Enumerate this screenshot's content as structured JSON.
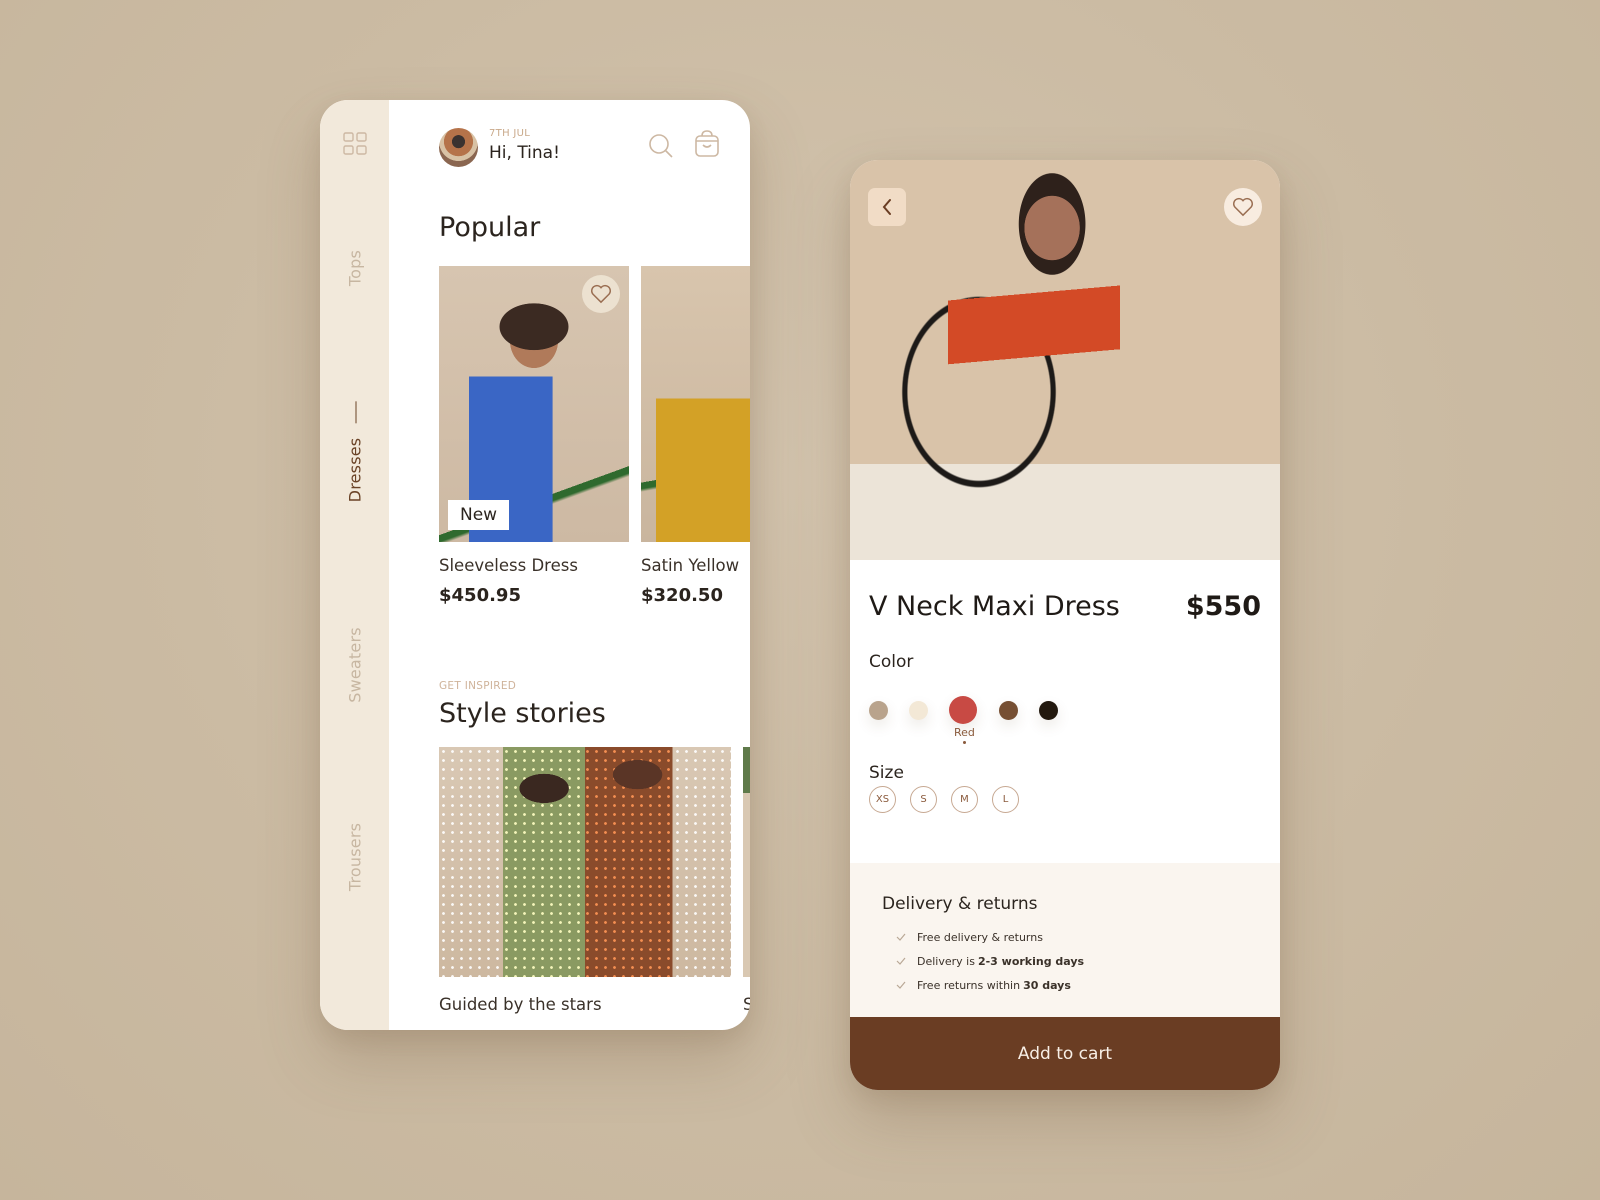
{
  "home": {
    "sidebar": {
      "menu_icon": "grid-icon",
      "categories": [
        {
          "label": "Tops",
          "active": false
        },
        {
          "label": "Dresses",
          "active": true
        },
        {
          "label": "Sweaters",
          "active": false
        },
        {
          "label": "Trousers",
          "active": false
        }
      ]
    },
    "header": {
      "date": "7TH JUL",
      "greeting": "Hi, Tina!",
      "search_icon": "search-icon",
      "cart_icon": "shopping-bag-icon"
    },
    "popular": {
      "title": "Popular",
      "products": [
        {
          "name": "Sleeveless Dress",
          "price": "$450.95",
          "badge": "New",
          "favorite_icon": "heart-icon"
        },
        {
          "name": "Satin Yellow",
          "price": "$320.50"
        }
      ]
    },
    "stories": {
      "eyebrow": "GET INSPIRED",
      "title": "Style stories",
      "items": [
        {
          "title": "Guided by the stars"
        },
        {
          "title": "S"
        }
      ]
    }
  },
  "detail": {
    "back_icon": "chevron-left-icon",
    "favorite_icon": "heart-icon",
    "title": "V Neck Maxi Dress",
    "price": "$550",
    "color": {
      "label": "Color",
      "options": [
        {
          "name": "Beige",
          "hex": "#b9a38c"
        },
        {
          "name": "Cream",
          "hex": "#f3e8d6"
        },
        {
          "name": "Red",
          "hex": "#c84a44"
        },
        {
          "name": "Brown",
          "hex": "#764f33"
        },
        {
          "name": "Black",
          "hex": "#23190f"
        }
      ],
      "selected": "Red"
    },
    "size": {
      "label": "Size",
      "options": [
        "XS",
        "S",
        "M",
        "L"
      ]
    },
    "delivery": {
      "title": "Delivery & returns",
      "items": [
        {
          "text": "Free delivery & returns",
          "bold": ""
        },
        {
          "text": "Delivery is",
          "bold": "2-3 working days"
        },
        {
          "text": "Free returns within",
          "bold": "30 days"
        }
      ]
    },
    "cta": "Add to cart"
  },
  "colors": {
    "accent_brown": "#6a3d23",
    "sidebar_bg": "#f2e9db",
    "delivery_bg": "#faf5ef"
  }
}
